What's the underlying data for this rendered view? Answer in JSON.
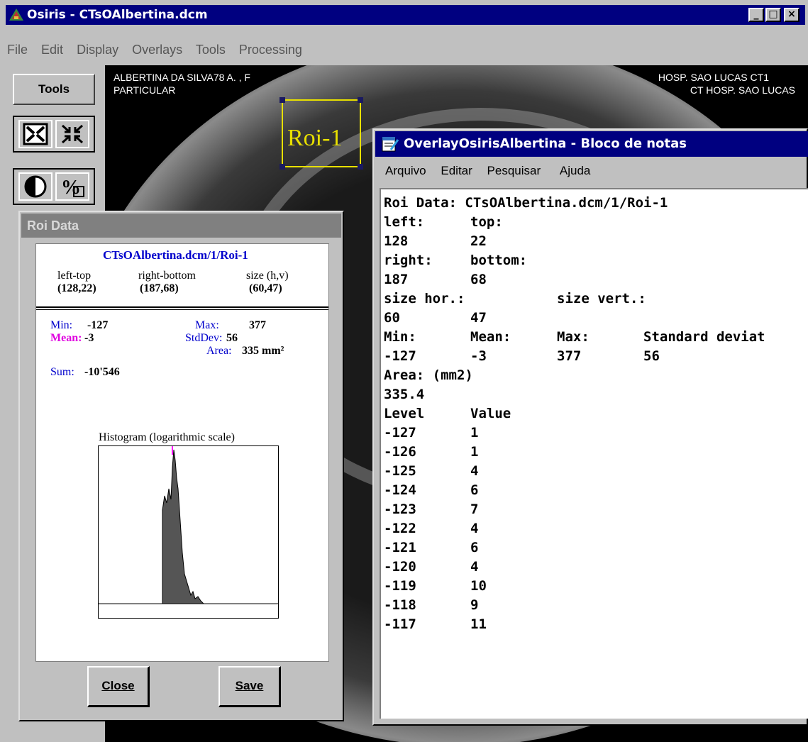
{
  "main_window": {
    "title": "Osiris - CTsOAlbertina.dcm",
    "minimize": "_",
    "maximize": "□",
    "close": "×"
  },
  "menu": [
    "File",
    "Edit",
    "Display",
    "Overlays",
    "Tools",
    "Processing"
  ],
  "toolbar": {
    "tools_label": "Tools"
  },
  "overlay": {
    "patient_line1": "ALBERTINA DA SILVA78 A. , F",
    "patient_line2": "PARTICULAR",
    "hosp_line1": "HOSP. SAO LUCAS CT1",
    "hosp_line2": "CT HOSP. SAO LUCAS",
    "roi_label": "Roi-1"
  },
  "roi_dialog": {
    "title": "Roi Data",
    "file": "CTsOAlbertina.dcm/1/Roi-1",
    "left_top_label": "left-top",
    "left_top_value": "(128,22)",
    "right_bottom_label": "right-bottom",
    "right_bottom_value": "(187,68)",
    "size_label": "size (h,v)",
    "size_value": "(60,47)",
    "min_label": "Min:",
    "min_value": "-127",
    "max_label": "Max:",
    "max_value": "377",
    "mean_label": "Mean:",
    "mean_value": "-3",
    "stddev_label": "StdDev:",
    "stddev_value": "56",
    "area_label": "Area:",
    "area_value": "335 mm²",
    "sum_label": "Sum:",
    "sum_value": "-10'546",
    "histogram_title": "Histogram (logarithmic scale)",
    "close_label": "Close",
    "save_label": "Save"
  },
  "notepad": {
    "title": "OverlayOsirisAlbertina - Bloco de notas",
    "menu": [
      "Arquivo",
      "Editar",
      "Pesquisar",
      "Ajuda"
    ],
    "header_line": "Roi Data: CTsOAlbertina.dcm/1/Roi-1",
    "left_label": "left:",
    "top_label": "top:",
    "left_value": "128",
    "top_value": "22",
    "right_label": "right:",
    "bottom_label": "bottom:",
    "right_value": "187",
    "bottom_value": "68",
    "size_hor_label": "size hor.:",
    "size_vert_label": "size vert.:",
    "size_hor_value": "60",
    "size_vert_value": "47",
    "min_label": "Min:",
    "mean_label": "Mean:",
    "max_label": "Max:",
    "std_label": "Standard deviat",
    "min_value": "-127",
    "mean_value": "-3",
    "max_value": "377",
    "std_value": "56",
    "area_label": "Area: (mm2)",
    "area_value": "335.4",
    "level_header": "Level",
    "value_header": "Value",
    "rows": [
      {
        "level": "-127",
        "value": "1"
      },
      {
        "level": "-126",
        "value": "1"
      },
      {
        "level": "-125",
        "value": "4"
      },
      {
        "level": "-124",
        "value": "6"
      },
      {
        "level": "-123",
        "value": "7"
      },
      {
        "level": "-122",
        "value": "4"
      },
      {
        "level": "-121",
        "value": "6"
      },
      {
        "level": "-120",
        "value": "4"
      },
      {
        "level": "-119",
        "value": "10"
      },
      {
        "level": "-118",
        "value": "9"
      },
      {
        "level": "-117",
        "value": "11"
      }
    ]
  }
}
